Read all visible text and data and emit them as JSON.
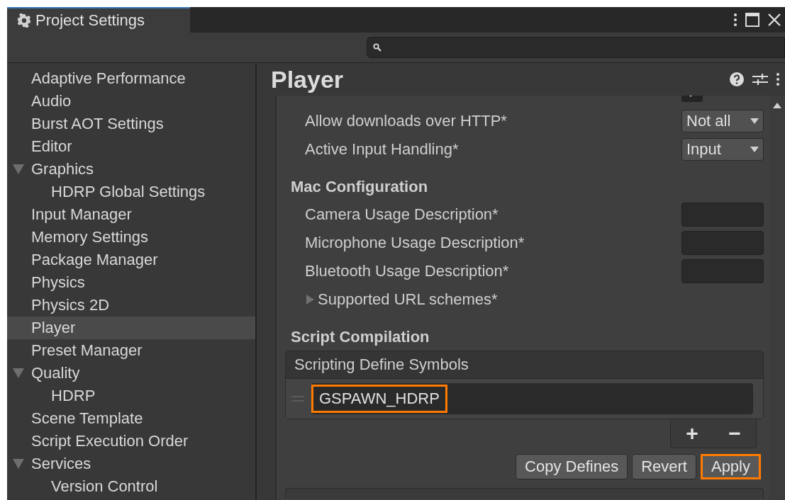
{
  "window": {
    "title": "Project Settings"
  },
  "sidebar": {
    "items": [
      {
        "label": "Adaptive Performance",
        "selected": false
      },
      {
        "label": "Audio",
        "selected": false
      },
      {
        "label": "Burst AOT Settings",
        "selected": false
      },
      {
        "label": "Editor",
        "selected": false
      },
      {
        "label": "Graphics",
        "selected": false,
        "expanded": true,
        "children": [
          {
            "label": "HDRP Global Settings",
            "selected": false
          }
        ]
      },
      {
        "label": "Input Manager",
        "selected": false
      },
      {
        "label": "Memory Settings",
        "selected": false
      },
      {
        "label": "Package Manager",
        "selected": false
      },
      {
        "label": "Physics",
        "selected": false
      },
      {
        "label": "Physics 2D",
        "selected": false
      },
      {
        "label": "Player",
        "selected": true
      },
      {
        "label": "Preset Manager",
        "selected": false
      },
      {
        "label": "Quality",
        "selected": false,
        "expanded": true,
        "children": [
          {
            "label": "HDRP",
            "selected": false
          }
        ]
      },
      {
        "label": "Scene Template",
        "selected": false
      },
      {
        "label": "Script Execution Order",
        "selected": false
      },
      {
        "label": "Services",
        "selected": false,
        "expanded": true,
        "children": [
          {
            "label": "Version Control",
            "selected": false
          }
        ]
      }
    ]
  },
  "panel": {
    "title": "Player",
    "sections": [
      {
        "rows": [
          {
            "kind": "checkbox",
            "checked": true
          },
          {
            "kind": "dropdown",
            "label": "Allow downloads over HTTP*",
            "value": "Not all"
          },
          {
            "kind": "dropdown",
            "label": "Active Input Handling*",
            "value": "Input"
          }
        ]
      },
      {
        "heading": "Mac Configuration",
        "rows": [
          {
            "kind": "textfield",
            "label": "Camera Usage Description*"
          },
          {
            "kind": "textfield",
            "label": "Microphone Usage Description*"
          },
          {
            "kind": "textfield",
            "label": "Bluetooth Usage Description*"
          },
          {
            "kind": "foldout",
            "label": "Supported URL schemes*",
            "expanded": false
          }
        ]
      },
      {
        "heading": "Script Compilation",
        "list": {
          "header": "Scripting Define Symbols",
          "items": [
            {
              "value": "GSPAWN_HDRP",
              "highlighted": true
            }
          ],
          "add": "+",
          "remove": "−"
        },
        "buttons": [
          {
            "label": "Copy Defines",
            "highlighted": false
          },
          {
            "label": "Revert",
            "highlighted": false
          },
          {
            "label": "Apply",
            "highlighted": true
          }
        ]
      }
    ]
  }
}
